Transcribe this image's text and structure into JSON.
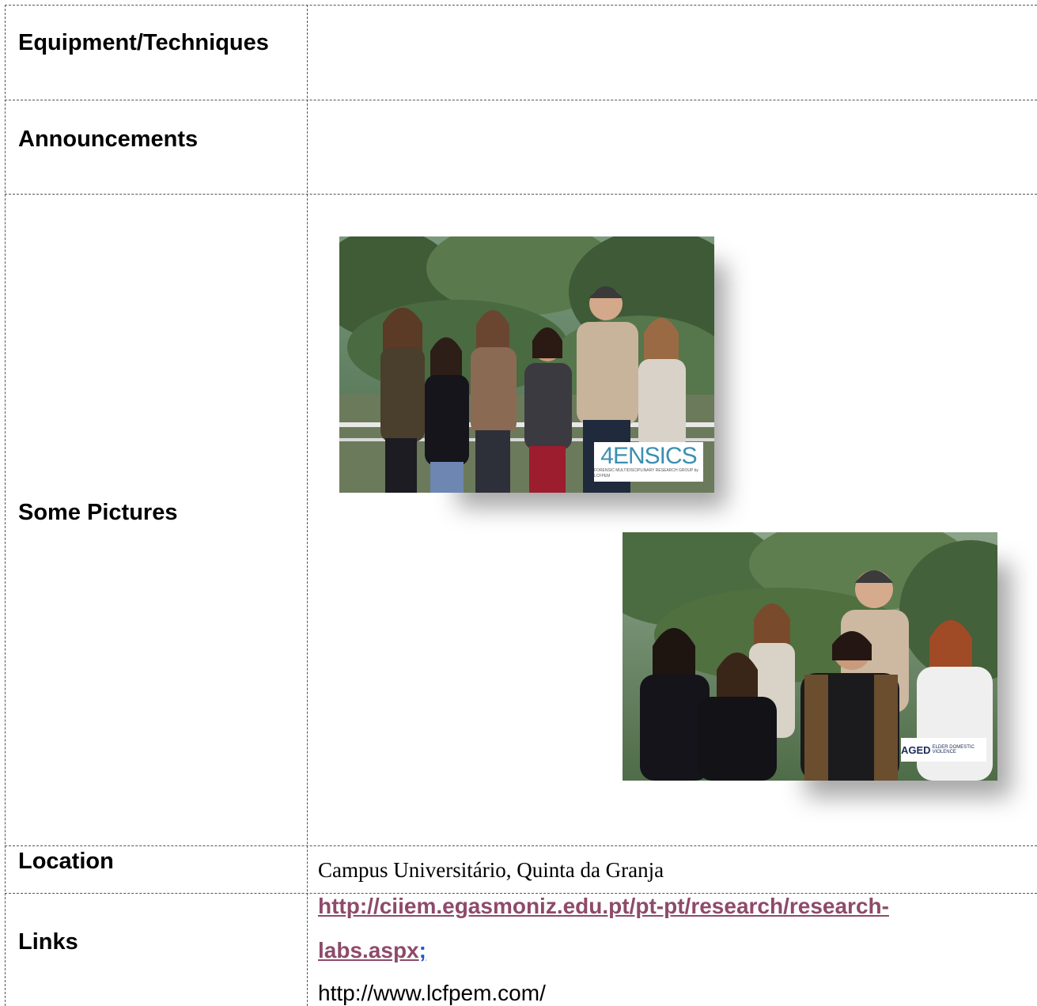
{
  "rows": {
    "equipment": {
      "label": "Equipment/Techniques"
    },
    "announcements": {
      "label": "Announcements"
    },
    "pictures": {
      "label": "Some Pictures"
    },
    "location": {
      "label": "Location",
      "value": "Campus Universitário, Quinta da Granja"
    },
    "links": {
      "label": "Links",
      "link_line1": "http://ciiem.egasmoniz.edu.pt/pt-pt/research/research-",
      "link_line2": "labs.aspx",
      "link_sep": ";",
      "url2": "http://www.lcfpem.com/"
    }
  },
  "photos": {
    "photo1": {
      "logo_text": "4ENSICS",
      "logo_sub": "FORENSIC MULTIDISCIPLINARY RESEARCH GROUP by LCFPEM"
    },
    "photo2": {
      "logo_text": "AGED",
      "logo_sub": "ELDER DOMESTIC VIOLENCE"
    }
  },
  "colors": {
    "link": "#8e4a6a",
    "separator": "#1f5ad1",
    "border": "#555555"
  }
}
